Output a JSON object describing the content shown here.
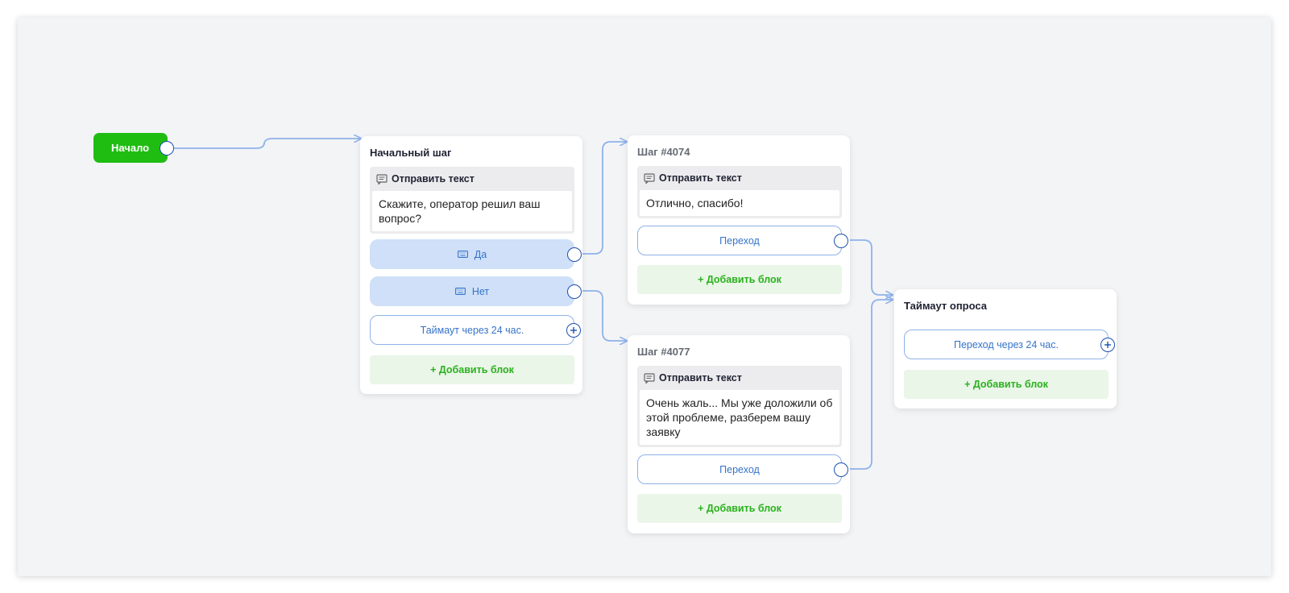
{
  "start": {
    "label": "Начало"
  },
  "cards": {
    "initial": {
      "title": "Начальный шаг",
      "message": {
        "header": "Отправить текст",
        "text": "Скажите, оператор решил ваш вопрос?"
      },
      "buttons": [
        "Да",
        "Нет"
      ],
      "timeout": "Таймаут через 24 час.",
      "add": "+ Добавить блок"
    },
    "step4074": {
      "title": "Шаг #4074",
      "message": {
        "header": "Отправить текст",
        "text": "Отлично, спасибо!"
      },
      "transition": "Переход",
      "add": "+ Добавить блок"
    },
    "step4077": {
      "title": "Шаг #4077",
      "message": {
        "header": "Отправить текст",
        "text": "Очень жаль... Мы уже доложили об этой проблеме, разберем вашу заявку"
      },
      "transition": "Переход",
      "add": "+ Добавить блок"
    },
    "timeout": {
      "title": "Таймаут опроса",
      "transition": "Переход через 24 час.",
      "add": "+ Добавить блок"
    }
  },
  "colors": {
    "canvas": "#f3f4f6",
    "start": "#1fbd12",
    "wire": "#8fb2ea",
    "port_border": "#1d4fb0",
    "button_fill": "#cfe0f8",
    "button_text": "#3573c9",
    "add_fill": "#eaf6e8",
    "add_text": "#2ab11e"
  },
  "icons": {
    "message": "message-icon",
    "keyboard": "keyboard-icon",
    "plus": "plus-icon"
  }
}
